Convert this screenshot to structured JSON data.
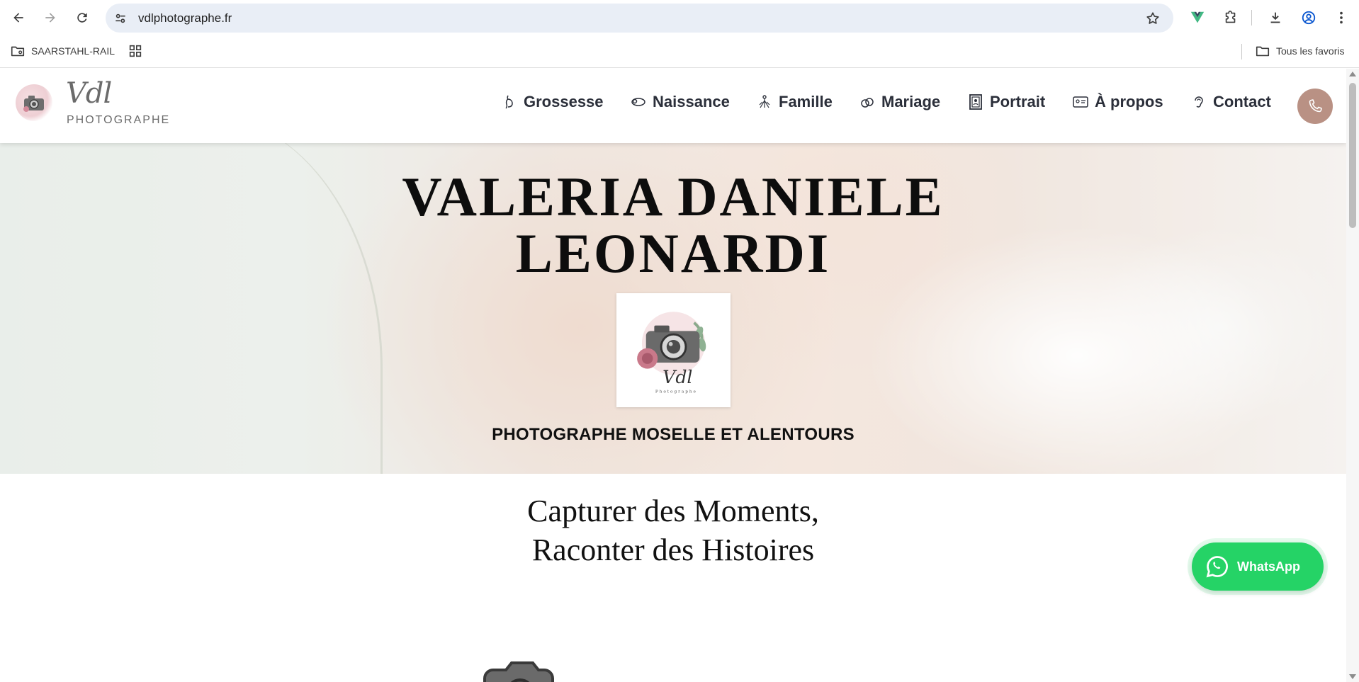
{
  "browser": {
    "url": "vdlphotographe.fr",
    "bookmarks": [
      {
        "label": "SAARSTAHL-RAIL",
        "icon": "folder-managed-icon"
      },
      {
        "label": "",
        "icon": "apps-grid-icon"
      }
    ],
    "all_bookmarks_label": "Tous les favoris"
  },
  "site": {
    "logo_script": "Vdl",
    "logo_sub": "PHOTOGRAPHE",
    "nav": [
      {
        "label": "Grossesse",
        "icon": "pregnancy-icon"
      },
      {
        "label": "Naissance",
        "icon": "baby-icon"
      },
      {
        "label": "Famille",
        "icon": "family-icon"
      },
      {
        "label": "Mariage",
        "icon": "rings-icon"
      },
      {
        "label": "Portrait",
        "icon": "portrait-icon"
      },
      {
        "label": "À propos",
        "icon": "id-card-icon"
      },
      {
        "label": "Contact",
        "icon": "ear-icon"
      }
    ],
    "accent_color": "#b99184"
  },
  "hero": {
    "title_line1": "VALERIA DANIELE",
    "title_line2": "LEONARDI",
    "logo_script": "Vdl",
    "logo_small": "Photographe",
    "subtitle": "PHOTOGRAPHE MOSELLE ET ALENTOURS"
  },
  "section": {
    "tagline_line1": "Capturer des Moments,",
    "tagline_line2": "Raconter des Histoires"
  },
  "whatsapp": {
    "label": "WhatsApp",
    "color": "#25d366"
  }
}
